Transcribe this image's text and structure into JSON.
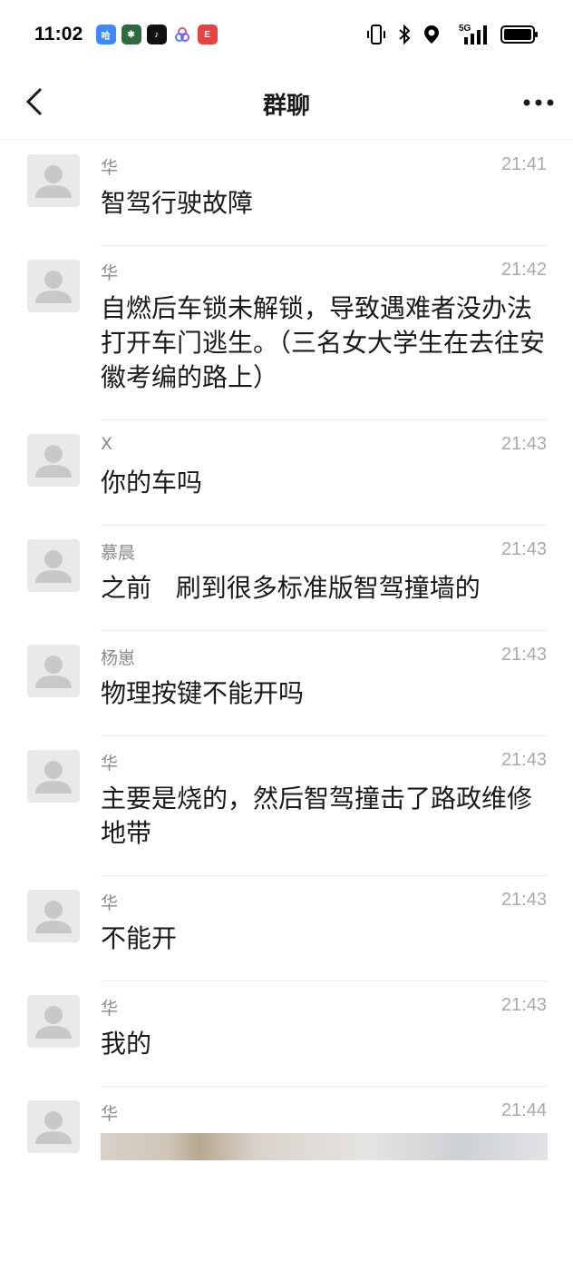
{
  "status_bar": {
    "time": "11:02",
    "app_icons": [
      "app-icon-1",
      "app-icon-2",
      "tiktok-icon",
      "app-icon-4",
      "app-icon-5"
    ],
    "network": "5G"
  },
  "nav": {
    "title": "群聊"
  },
  "messages": [
    {
      "sender": "华",
      "time": "21:41",
      "text": "智驾行驶故障"
    },
    {
      "sender": "华",
      "time": "21:42",
      "text": "自燃后车锁未解锁，导致遇难者没办法打开车门逃生。（三名女大学生在去往安徽考编的路上）"
    },
    {
      "sender": "X",
      "time": "21:43",
      "text": "你的车吗"
    },
    {
      "sender": "慕晨",
      "time": "21:43",
      "text": "之前   刷到很多标准版智驾撞墙的"
    },
    {
      "sender": "杨崽",
      "time": "21:43",
      "text": "物理按键不能开吗"
    },
    {
      "sender": "华",
      "time": "21:43",
      "text": "主要是烧的，然后智驾撞击了路政维修地带"
    },
    {
      "sender": "华",
      "time": "21:43",
      "text": "不能开"
    },
    {
      "sender": "华",
      "time": "21:43",
      "text": "我的"
    },
    {
      "sender": "华",
      "time": "21:44",
      "text": ""
    }
  ]
}
